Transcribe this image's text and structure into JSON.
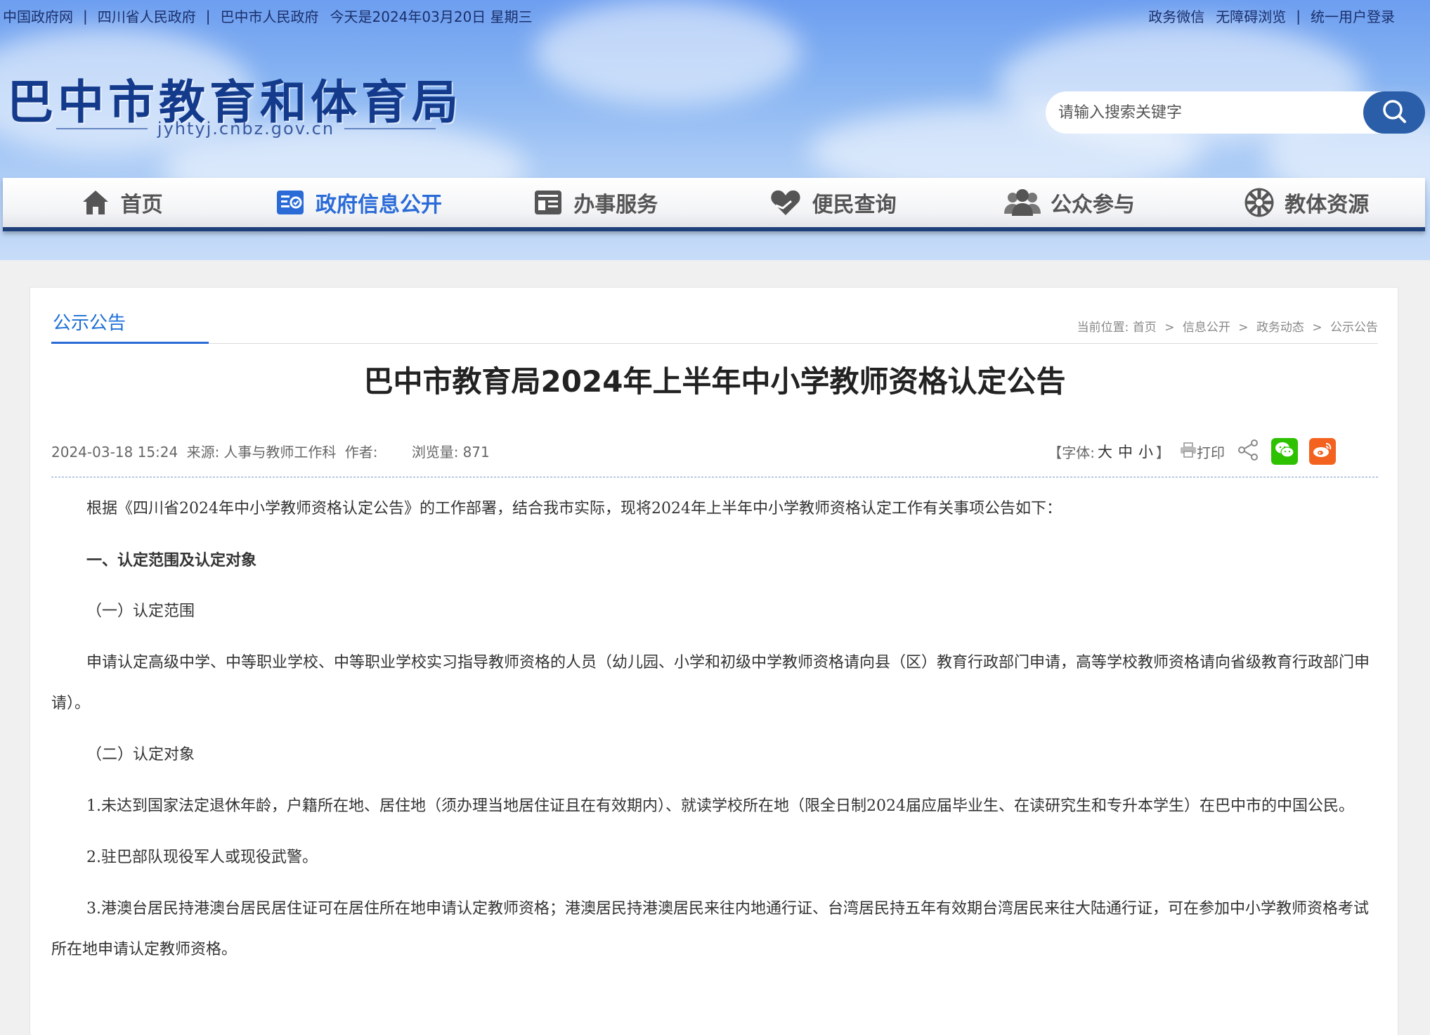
{
  "topbar": {
    "links": [
      "中国政府网",
      "四川省人民政府",
      "巴中市人民政府"
    ],
    "date": "今天是2024年03月20日 星期三",
    "right_links": [
      "政务微信",
      "无障碍浏览",
      "统一用户登录"
    ]
  },
  "site": {
    "title": "巴中市教育和体育局",
    "domain": "jyhtyj.cnbz.gov.cn"
  },
  "search": {
    "placeholder": "请输入搜索关键字",
    "icon": "search-icon"
  },
  "nav": [
    {
      "label": "首页",
      "icon": "home-icon",
      "active": false
    },
    {
      "label": "政府信息公开",
      "icon": "info-disclosure-icon",
      "active": true
    },
    {
      "label": "办事服务",
      "icon": "service-icon",
      "active": false
    },
    {
      "label": "便民查询",
      "icon": "heart-hand-icon",
      "active": false
    },
    {
      "label": "公众参与",
      "icon": "people-icon",
      "active": false
    },
    {
      "label": "教体资源",
      "icon": "resource-icon",
      "active": false
    }
  ],
  "section": {
    "title": "公示公告"
  },
  "breadcrumb": {
    "prefix": "当前位置:",
    "items": [
      "首页",
      "信息公开",
      "政务动态",
      "公示公告"
    ],
    "separator": ">"
  },
  "article": {
    "title": "巴中市教育局2024年上半年中小学教师资格认定公告",
    "datetime": "2024-03-18 15:24",
    "source_label": "来源:",
    "source": "人事与教师工作科",
    "author_label": "作者:",
    "author": "",
    "views_label": "浏览量:",
    "views": "871",
    "font_label_open": "【字体:",
    "font_sizes": [
      "大",
      "中",
      "小"
    ],
    "font_label_close": "】",
    "print_label": "打印",
    "paragraphs": [
      "根据《四川省2024年中小学教师资格认定公告》的工作部署，结合我市实际，现将2024年上半年中小学教师资格认定工作有关事项公告如下：",
      "一、认定范围及认定对象",
      "（一）认定范围",
      "申请认定高级中学、中等职业学校、中等职业学校实习指导教师资格的人员（幼儿园、小学和初级中学教师资格请向县（区）教育行政部门申请，高等学校教师资格请向省级教育行政部门申请）。",
      "（二）认定对象",
      "1.未达到国家法定退休年龄，户籍所在地、居住地（须办理当地居住证且在有效期内）、就读学校所在地（限全日制2024届应届毕业生、在读研究生和专升本学生）在巴中市的中国公民。",
      "2.驻巴部队现役军人或现役武警。",
      "3.港澳台居民持港澳台居民居住证可在居住所在地申请认定教师资格；港澳居民持港澳居民来往内地通行证、台湾居民持五年有效期台湾居民来往大陆通行证，可在参加中小学教师资格考试所在地申请认定教师资格。"
    ]
  },
  "colors": {
    "header_top": "#6d9ef0",
    "nav_active": "#2a6bd8",
    "nav_border": "#1f3f7a",
    "wechat": "#2dc100",
    "weibo": "#f3621e"
  }
}
